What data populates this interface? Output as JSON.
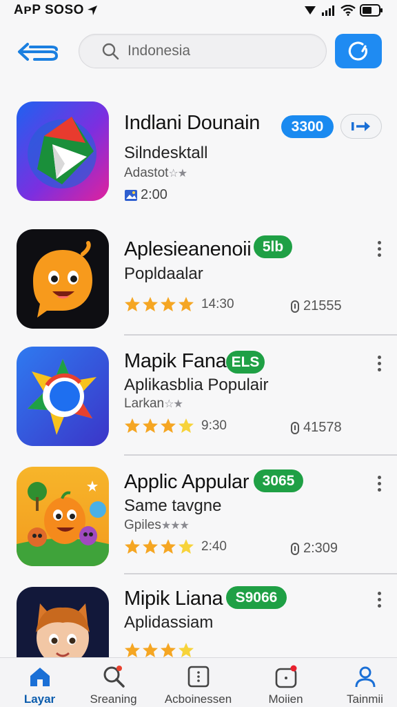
{
  "status_bar": {
    "carrier": "AᴘP SOSO"
  },
  "search": {
    "placeholder": "Indonesia"
  },
  "apps": [
    {
      "name": "Indlani Dounain",
      "badge": "3300",
      "badge_color": "#1a8af0",
      "subtitle": "Silndesktall",
      "developer": "Adastot",
      "size": "2:00"
    },
    {
      "name": "Aplesieanenoii",
      "badge": "5lb",
      "badge_color": "#1fa045",
      "subtitle": "Popldaalar",
      "rating_stars": 4,
      "rating_text": "14:30",
      "downloads": "21555"
    },
    {
      "name": "Mapik Fana",
      "badge": "ELS",
      "badge_color": "#1fa045",
      "subtitle": "Aplikasblia Populair",
      "developer": "Larkan",
      "rating_stars": 3.5,
      "rating_text": "9:30",
      "downloads": "41578"
    },
    {
      "name": "Applic Appular",
      "badge": "3065",
      "badge_color": "#1fa045",
      "subtitle": "Same tavgne",
      "developer": "Gpiles",
      "rating_stars": 3.5,
      "rating_text": "2:40",
      "downloads": "2:309"
    },
    {
      "name": "Mipik Liana",
      "badge": "S9066",
      "badge_color": "#1fa045",
      "subtitle": "Aplidassiam",
      "rating_stars": 4
    }
  ],
  "bottom_nav": [
    {
      "label": "Layar",
      "icon": "home-icon",
      "active": true
    },
    {
      "label": "Sreaning",
      "icon": "search-icon",
      "active": false
    },
    {
      "label": "Acboinessen",
      "icon": "grid-icon",
      "active": false
    },
    {
      "label": "Moiien",
      "icon": "notification-icon",
      "active": false
    },
    {
      "label": "Tainmii",
      "icon": "profile-icon",
      "active": false
    }
  ],
  "colors": {
    "accent": "#1f8bf2",
    "badge_green": "#1fa045",
    "star": "#f5a623",
    "active_nav": "#0b5cad"
  }
}
